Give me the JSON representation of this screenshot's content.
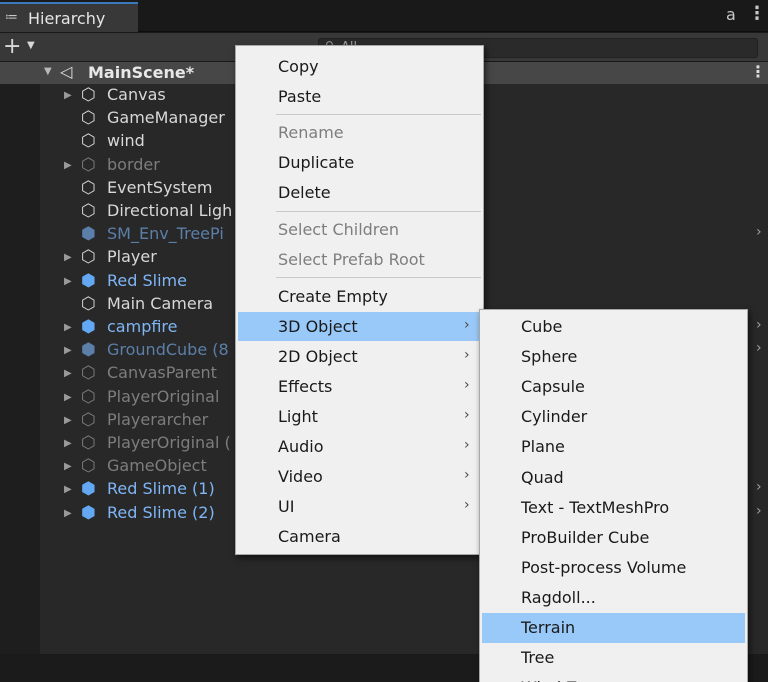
{
  "window": {
    "tab_icon": "≔",
    "tab_label": "Hierarchy",
    "lock_icon": "a",
    "kebab": "⋮"
  },
  "toolbar": {
    "add_icon": "+",
    "add_dropdown_icon": "▼",
    "search_icon": "⚲",
    "search_text": "All"
  },
  "scene": {
    "fold_icon": "▼",
    "scene_icon": "◁",
    "name": "MainScene*",
    "kebab": "⋮"
  },
  "hierarchy": {
    "items": [
      {
        "label": "Canvas",
        "fold": "▶",
        "style": "normal"
      },
      {
        "label": "GameManager",
        "fold": "",
        "style": "normal"
      },
      {
        "label": "wind",
        "fold": "",
        "style": "normal"
      },
      {
        "label": "border",
        "fold": "▶",
        "style": "disabled"
      },
      {
        "label": "EventSystem",
        "fold": "",
        "style": "normal"
      },
      {
        "label": "Directional Ligh",
        "fold": "",
        "style": "normal"
      },
      {
        "label": "SM_Env_TreePi",
        "fold": "",
        "style": "prefab-disabled",
        "arrow": "›"
      },
      {
        "label": "Player",
        "fold": "▶",
        "style": "normal"
      },
      {
        "label": "Red Slime",
        "fold": "▶",
        "style": "prefab"
      },
      {
        "label": "Main Camera",
        "fold": "",
        "style": "normal"
      },
      {
        "label": "campfire",
        "fold": "▶",
        "style": "prefab",
        "arrow": "›"
      },
      {
        "label": "GroundCube (8",
        "fold": "▶",
        "style": "prefab-disabled",
        "arrow": "›"
      },
      {
        "label": "CanvasParent",
        "fold": "▶",
        "style": "disabled"
      },
      {
        "label": "PlayerOriginal",
        "fold": "▶",
        "style": "disabled"
      },
      {
        "label": "Playerarcher",
        "fold": "▶",
        "style": "disabled"
      },
      {
        "label": "PlayerOriginal (",
        "fold": "▶",
        "style": "disabled"
      },
      {
        "label": "GameObject",
        "fold": "▶",
        "style": "disabled"
      },
      {
        "label": "Red Slime (1)",
        "fold": "▶",
        "style": "prefab",
        "arrow": "›"
      },
      {
        "label": "Red Slime (2)",
        "fold": "▶",
        "style": "prefab",
        "arrow": "›"
      }
    ],
    "cube_icon": "⬡",
    "prefab_icon": "⬢"
  },
  "context_menu": {
    "copy": "Copy",
    "paste": "Paste",
    "rename": "Rename",
    "duplicate": "Duplicate",
    "delete": "Delete",
    "select_children": "Select Children",
    "select_prefab_root": "Select Prefab Root",
    "create_empty": "Create Empty",
    "object_3d": "3D Object",
    "object_2d": "2D Object",
    "effects": "Effects",
    "light": "Light",
    "audio": "Audio",
    "video": "Video",
    "ui": "UI",
    "camera": "Camera",
    "submenu_arrow": "›"
  },
  "submenu_3d": {
    "items": [
      "Cube",
      "Sphere",
      "Capsule",
      "Cylinder",
      "Plane",
      "Quad",
      "Text - TextMeshPro",
      "ProBuilder Cube",
      "Post-process Volume",
      "Ragdoll...",
      "Terrain",
      "Tree",
      "Wind Zone"
    ],
    "highlighted": "Terrain"
  },
  "colors": {
    "highlight": "#99c9f8",
    "prefab_blue": "#7fb6f5",
    "tab_accent": "#3a79bb"
  }
}
